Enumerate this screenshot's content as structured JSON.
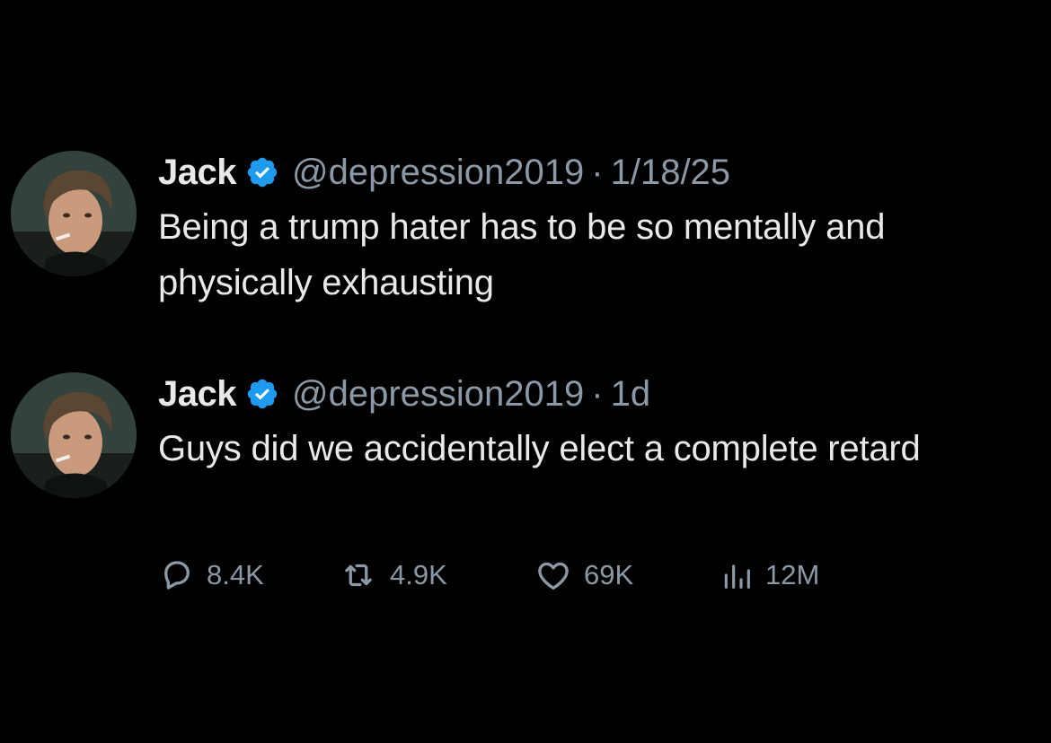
{
  "tweets": [
    {
      "display_name": "Jack",
      "handle": "@depression2019",
      "separator": "·",
      "timestamp": "1/18/25",
      "text": "Being a trump hater has to be so mentally and physically exhausting",
      "avatar_icon": "profile-photo",
      "verified_icon": "verified-badge-icon"
    },
    {
      "display_name": "Jack",
      "handle": "@depression2019",
      "separator": "·",
      "timestamp": "1d",
      "text": "Guys did we accidentally elect a complete retard",
      "avatar_icon": "profile-photo",
      "verified_icon": "verified-badge-icon"
    }
  ],
  "actions": {
    "replies": "8.4K",
    "reposts": "4.9K",
    "likes": "69K",
    "views": "12M"
  },
  "colors": {
    "background": "#000000",
    "primary_text": "#e7e9ea",
    "secondary_text": "#8b98a5",
    "verified_blue": "#1d9bf0"
  }
}
